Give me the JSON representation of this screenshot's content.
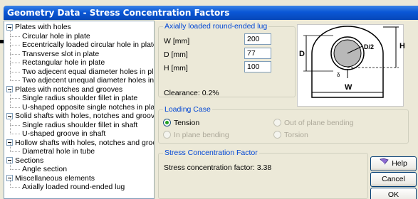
{
  "window": {
    "title": "Geometry Data - Stress Concentration Factors"
  },
  "tree": [
    {
      "label": "Plates with holes",
      "level": 0
    },
    {
      "label": "Circular hole in plate",
      "level": 1
    },
    {
      "label": "Eccentrically loaded circular hole in plate",
      "level": 1
    },
    {
      "label": "Transverse slot in plate",
      "level": 1
    },
    {
      "label": "Rectangular hole in plate",
      "level": 1
    },
    {
      "label": "Two adjecent equal diameter holes in plate",
      "level": 1
    },
    {
      "label": "Two adjecent unequal diameter holes in plate",
      "level": 1
    },
    {
      "label": "Plates with notches and grooves",
      "level": 0
    },
    {
      "label": "Single radius shoulder fillet in plate",
      "level": 1
    },
    {
      "label": "U-shaped opposite single notches in plate",
      "level": 1
    },
    {
      "label": "Solid shafts with holes, notches and grooves",
      "level": 0
    },
    {
      "label": "Single radius shoulder fillet in shaft",
      "level": 1
    },
    {
      "label": "U-shaped groove in shaft",
      "level": 1
    },
    {
      "label": "Hollow shafts with holes, notches and grooves",
      "level": 0
    },
    {
      "label": "Diametral hole in tube",
      "level": 1
    },
    {
      "label": "Sections",
      "level": 0
    },
    {
      "label": "Angle section",
      "level": 1
    },
    {
      "label": "Miscellaneous elements",
      "level": 0
    },
    {
      "label": "Axially loaded round-ended lug",
      "level": 1
    }
  ],
  "geometry": {
    "group_label": "Axially loaded round-ended lug",
    "fields": [
      {
        "label": "W [mm]",
        "value": "200"
      },
      {
        "label": "D [mm]",
        "value": "77"
      },
      {
        "label": "H [mm]",
        "value": "100"
      }
    ],
    "clearance": "Clearance: 0.2%",
    "diagram": {
      "label_h_right": "H",
      "label_d_left": "D",
      "label_d2": "D/2",
      "label_w": "W",
      "label_small": "δ"
    }
  },
  "loading": {
    "group_label": "Loading Case",
    "options": [
      {
        "label": "Tension",
        "selected": true,
        "enabled": true
      },
      {
        "label": "Out of plane bending",
        "selected": false,
        "enabled": false
      },
      {
        "label": "In plane bending",
        "selected": false,
        "enabled": false
      },
      {
        "label": "Torsion",
        "selected": false,
        "enabled": false
      }
    ]
  },
  "stress": {
    "group_label": "Stress Concentration Factor",
    "result": "Stress concentration factor: 3.38"
  },
  "buttons": {
    "help": "Help",
    "cancel": "Cancel",
    "ok": "OK",
    "help_icon": "help-book-icon"
  }
}
